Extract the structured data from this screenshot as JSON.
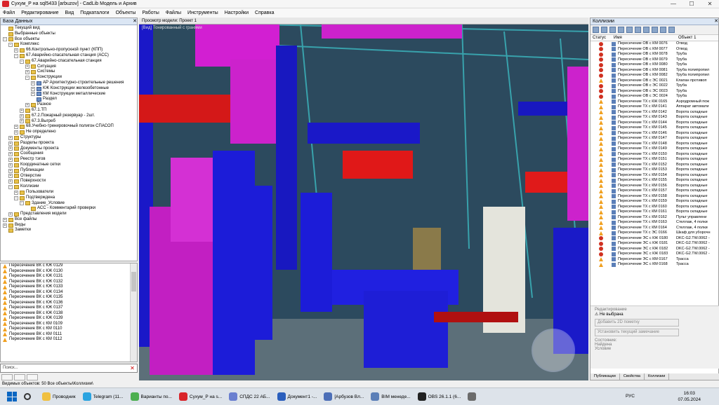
{
  "window": {
    "title": "Сухум_Р на sql5433 [arbuzov] - CadLib Модель и Архив",
    "minimize": "—",
    "maximize": "☐",
    "close": "✕"
  },
  "menu": [
    "Файл",
    "Редактирование",
    "Вид",
    "Подкаталоги",
    "Объекты",
    "Работы",
    "Файлы",
    "Инструменты",
    "Настройки",
    "Справка"
  ],
  "db_panel": {
    "title": "База Данных",
    "tree": [
      {
        "indent": 0,
        "exp": "",
        "label": "Текущий вид"
      },
      {
        "indent": 0,
        "exp": "",
        "label": "Выбранные объекты"
      },
      {
        "indent": 0,
        "exp": "−",
        "label": "Все объекты"
      },
      {
        "indent": 1,
        "exp": "−",
        "label": "Комплекс"
      },
      {
        "indent": 2,
        "exp": "+",
        "label": "66.Контрольно-пропускной пункт (КПП)"
      },
      {
        "indent": 2,
        "exp": "−",
        "label": "67.Аварийно-спасательная станция (АСС)"
      },
      {
        "indent": 3,
        "exp": "−",
        "label": "67.Аварийно-спасательная станция"
      },
      {
        "indent": 4,
        "exp": "+",
        "label": "Ситуация"
      },
      {
        "indent": 4,
        "exp": "+",
        "label": "Системы"
      },
      {
        "indent": 4,
        "exp": "−",
        "label": "Конструкции"
      },
      {
        "indent": 5,
        "exp": "+",
        "label": "АР Архитектурно-строительные решения"
      },
      {
        "indent": 5,
        "exp": "+",
        "label": "КЖ Конструкции железобетонные"
      },
      {
        "indent": 5,
        "exp": "+",
        "label": "КМ Конструкции металлические"
      },
      {
        "indent": 5,
        "exp": "",
        "label": "Раздел"
      },
      {
        "indent": 4,
        "exp": "+",
        "label": "Разное"
      },
      {
        "indent": 3,
        "exp": "+",
        "label": "67.1.ТП"
      },
      {
        "indent": 3,
        "exp": "+",
        "label": "67.2.Пожарный резервуар - 2шт."
      },
      {
        "indent": 3,
        "exp": "+",
        "label": "67.3.Выгреб"
      },
      {
        "indent": 2,
        "exp": "+",
        "label": "68.Учебно-тренировочный полигон СПАСОП"
      },
      {
        "indent": 2,
        "exp": "+",
        "label": "Не определено"
      },
      {
        "indent": 1,
        "exp": "+",
        "label": "Структуры"
      },
      {
        "indent": 1,
        "exp": "+",
        "label": "Разделы проекта"
      },
      {
        "indent": 1,
        "exp": "+",
        "label": "Документы проекта"
      },
      {
        "indent": 1,
        "exp": "+",
        "label": "Сообщения"
      },
      {
        "indent": 1,
        "exp": "+",
        "label": "Реестр тэгов"
      },
      {
        "indent": 1,
        "exp": "+",
        "label": "Координатные сетки"
      },
      {
        "indent": 1,
        "exp": "+",
        "label": "Публикации"
      },
      {
        "indent": 1,
        "exp": "+",
        "label": "Отверстие"
      },
      {
        "indent": 1,
        "exp": "+",
        "label": "Поверхности"
      },
      {
        "indent": 1,
        "exp": "−",
        "label": "Коллизии"
      },
      {
        "indent": 2,
        "exp": "+",
        "label": "Пользователи"
      },
      {
        "indent": 2,
        "exp": "−",
        "label": "Подтверждена"
      },
      {
        "indent": 3,
        "exp": "−",
        "label": "Здание_Условие"
      },
      {
        "indent": 4,
        "exp": "",
        "label": "АСС - Комментарий проверки"
      },
      {
        "indent": 1,
        "exp": "+",
        "label": "Представления модели"
      },
      {
        "indent": 0,
        "exp": "+",
        "label": "Все файлы"
      },
      {
        "indent": 0,
        "exp": "+",
        "label": "Виды"
      },
      {
        "indent": 0,
        "exp": "",
        "label": "Заметки"
      }
    ]
  },
  "collision_list": [
    "Пересечение ВК с КЖ 0129",
    "Пересечение ВК с КЖ 0130",
    "Пересечение ВК с КЖ 0131",
    "Пересечение ВК с КЖ 0132",
    "Пересечение ВК с КЖ 0133",
    "Пересечение ВК с КЖ 0134",
    "Пересечение ВК с КЖ 0135",
    "Пересечение ВК с КЖ 0136",
    "Пересечение ВК с КЖ 0137",
    "Пересечение ВК с КЖ 0138",
    "Пересечение ВК с КЖ 0139",
    "Пересечение ВК с КМ 0109",
    "Пересечение ВК с КМ 0110",
    "Пересечение ВК с КМ 0111",
    "Пересечение ВК с КМ 0112"
  ],
  "search": {
    "placeholder": "Поиск...",
    "clear": "✕"
  },
  "status": {
    "text": "Видимых объектов: 50  Все объекты\\Коллизии\\"
  },
  "viewport": {
    "title": "Просмотр модели: Проект 1",
    "label": "[Вид] Тонированный с гранями"
  },
  "right_panel": {
    "title": "Коллизии",
    "col_status": "Статус",
    "col_name": "Имя",
    "col_obj": "Объект 1",
    "rows": [
      {
        "s": "dot",
        "n": "Пересечение ОВ с КМ 0076",
        "o": "Отвод"
      },
      {
        "s": "dot",
        "n": "Пересечение ОВ с КМ 0077",
        "o": "Отвод"
      },
      {
        "s": "dot",
        "n": "Пересечение ОВ с КМ 0078",
        "o": "Труба"
      },
      {
        "s": "dot",
        "n": "Пересечение ОВ с КМ 0079",
        "o": "Труба"
      },
      {
        "s": "dot",
        "n": "Пересечение ОВ с КМ 0080",
        "o": "Труба"
      },
      {
        "s": "dot",
        "n": "Пересечение ОВ с КМ 0081",
        "o": "Труба полипропил"
      },
      {
        "s": "dot",
        "n": "Пересечение ОВ с КМ 0082",
        "o": "Труба полипропил"
      },
      {
        "s": "tri",
        "n": "Пересечение ОВ с ЭС 0021",
        "o": "Клапан противоп"
      },
      {
        "s": "dot",
        "n": "Пересечение ОВ с ЭС 0022",
        "o": "Труба"
      },
      {
        "s": "dot",
        "n": "Пересечение ОВ с ЭС 0023",
        "o": "Труба"
      },
      {
        "s": "dot",
        "n": "Пересечение ОВ с ЭС 0024",
        "o": "Труба"
      },
      {
        "s": "tri",
        "n": "Пересечение ТХ с КЖ 0165",
        "o": "Аэродромный пож"
      },
      {
        "s": "tri",
        "n": "Пересечение ТХ с КМ 0141",
        "o": "Аппарат автомати"
      },
      {
        "s": "tri",
        "n": "Пересечение ТХ с КМ 0142",
        "o": "Ворота складные"
      },
      {
        "s": "tri",
        "n": "Пересечение ТХ с КМ 0143",
        "o": "Ворота складные"
      },
      {
        "s": "tri",
        "n": "Пересечение ТХ с КМ 0144",
        "o": "Ворота складные"
      },
      {
        "s": "tri",
        "n": "Пересечение ТХ с КМ 0145",
        "o": "Ворота складные"
      },
      {
        "s": "tri",
        "n": "Пересечение ТХ с КМ 0146",
        "o": "Ворота складные"
      },
      {
        "s": "tri",
        "n": "Пересечение ТХ с КМ 0147",
        "o": "Ворота складные"
      },
      {
        "s": "tri",
        "n": "Пересечение ТХ с КМ 0148",
        "o": "Ворота складные"
      },
      {
        "s": "tri",
        "n": "Пересечение ТХ с КМ 0149",
        "o": "Ворота складные"
      },
      {
        "s": "tri",
        "n": "Пересечение ТХ с КМ 0150",
        "o": "Ворота складные"
      },
      {
        "s": "tri",
        "n": "Пересечение ТХ с КМ 0151",
        "o": "Ворота складные"
      },
      {
        "s": "tri",
        "n": "Пересечение ТХ с КМ 0152",
        "o": "Ворота складные"
      },
      {
        "s": "tri",
        "n": "Пересечение ТХ с КМ 0153",
        "o": "Ворота складные"
      },
      {
        "s": "tri",
        "n": "Пересечение ТХ с КМ 0154",
        "o": "Ворота складные"
      },
      {
        "s": "tri",
        "n": "Пересечение ТХ с КМ 0155",
        "o": "Ворота складные"
      },
      {
        "s": "tri",
        "n": "Пересечение ТХ с КМ 0156",
        "o": "Ворота складные"
      },
      {
        "s": "tri",
        "n": "Пересечение ТХ с КМ 0157",
        "o": "Ворота складные"
      },
      {
        "s": "tri",
        "n": "Пересечение ТХ с КМ 0158",
        "o": "Ворота складные"
      },
      {
        "s": "tri",
        "n": "Пересечение ТХ с КМ 0159",
        "o": "Ворота складные"
      },
      {
        "s": "tri",
        "n": "Пересечение ТХ с КМ 0160",
        "o": "Ворота складные"
      },
      {
        "s": "tri",
        "n": "Пересечение ТХ с КМ 0161",
        "o": "Ворота складные"
      },
      {
        "s": "tri",
        "n": "Пересечение ТХ с КМ 0162",
        "o": "Пульт управлени"
      },
      {
        "s": "tri",
        "n": "Пересечение ТХ с КМ 0163",
        "o": "Стеллаж, 4 полки"
      },
      {
        "s": "tri",
        "n": "Пересечение ТХ с КМ 0164",
        "o": "Стеллаж, 4 полки"
      },
      {
        "s": "tri",
        "n": "Пересечение ТХ с ЭС 0166",
        "o": "Шкаф для уборочн"
      },
      {
        "s": "dot",
        "n": "Пересечение ЭС с КЖ 0180",
        "o": "DKC-G2.TW.0062 -"
      },
      {
        "s": "dot",
        "n": "Пересечение ЭС с КЖ 0181",
        "o": "DKC-G2.TW.0062 -"
      },
      {
        "s": "dot",
        "n": "Пересечение ЭС с КЖ 0182",
        "o": "DKC-G2.TW.0062 -"
      },
      {
        "s": "dot",
        "n": "Пересечение ЭС с КЖ 0183",
        "o": "DKC-G2.TW.0062 -"
      },
      {
        "s": "tri",
        "n": "Пересечение ЭС с КМ 0167",
        "o": "Трасса"
      },
      {
        "s": "tri",
        "n": "Пересечение ЭС с КМ 0168",
        "o": "Трасса"
      }
    ],
    "edit_title": "Редактирование",
    "edit_status": "Не выбрана",
    "edit_add": "Добавить 2D пометку",
    "edit_set": "Установить текущий замечание",
    "state_lbl": "Состояние:",
    "found": "Найдена",
    "cond": "Условие"
  },
  "rtabs": [
    "Публикации",
    "Свойства",
    "Коллизии"
  ],
  "taskbar": {
    "apps": [
      "Проводник",
      "Telegram (11...",
      "Варианты по...",
      "Сухум_Р на s...",
      "СПДС 22 АБ...",
      "Документ1 -...",
      "[Арбузов Вл...",
      "BIM менеде...",
      "OBS 26.1.1 (6...",
      ""
    ],
    "lang": "РУС",
    "time": "16:03",
    "date": "07.05.2024"
  },
  "colors": {
    "accent": "#d9242a",
    "taskbar_apps": [
      "#f0c040",
      "#2aa3e0",
      "#4caf50",
      "#d9242a",
      "#6a7fd0",
      "#2b5fbd",
      "#4d6fb7",
      "#5b7fb8",
      "#222222",
      "#6b6b6b"
    ]
  }
}
